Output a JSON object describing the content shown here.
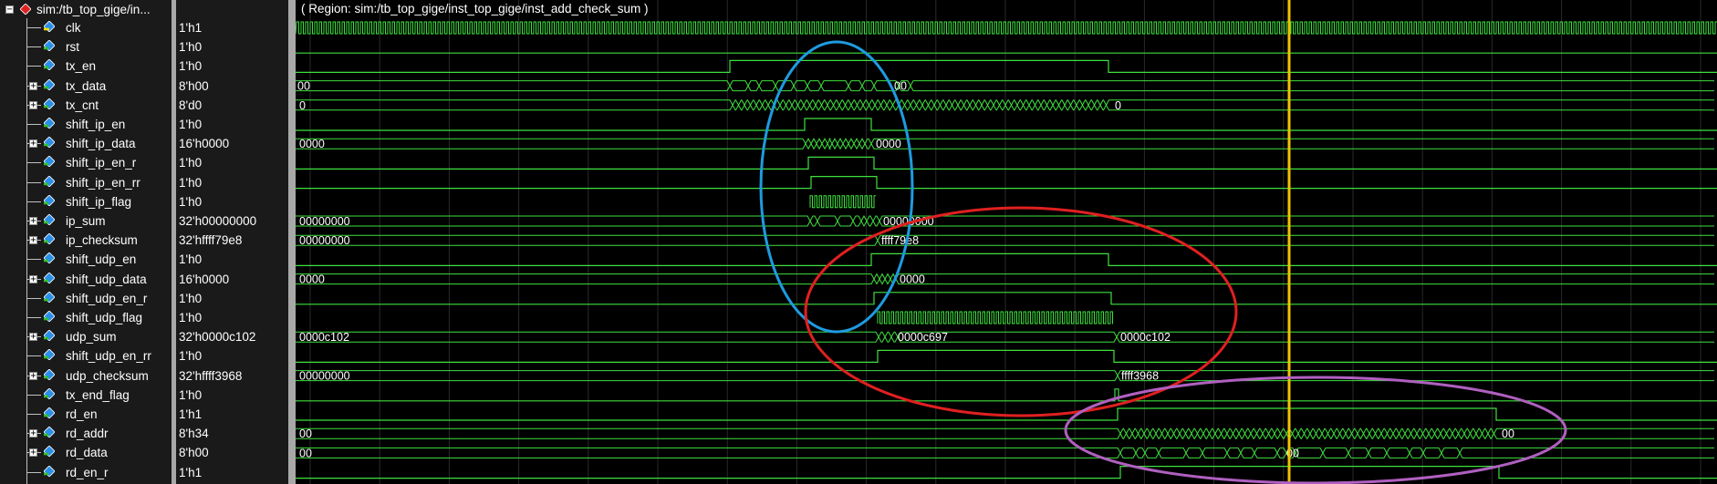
{
  "root_scope": "sim:/tb_top_gige/in...",
  "region_label": "( Region: sim:/tb_top_gige/inst_top_gige/inst_add_check_sum )",
  "colors": {
    "wave": "#3ee03e",
    "cursor": "#f2c200",
    "blue_ellipse": "#1e9be0",
    "red_ellipse": "#e02020",
    "purple_ellipse": "#b060c0"
  },
  "signals": [
    {
      "name": "clk",
      "value": "1'h1",
      "bus": false
    },
    {
      "name": "rst",
      "value": "1'h0",
      "bus": false
    },
    {
      "name": "tx_en",
      "value": "1'h0",
      "bus": false
    },
    {
      "name": "tx_data",
      "value": "8'h00",
      "bus": true
    },
    {
      "name": "tx_cnt",
      "value": "8'd0",
      "bus": true
    },
    {
      "name": "shift_ip_en",
      "value": "1'h0",
      "bus": false
    },
    {
      "name": "shift_ip_data",
      "value": "16'h0000",
      "bus": true
    },
    {
      "name": "shift_ip_en_r",
      "value": "1'h0",
      "bus": false
    },
    {
      "name": "shift_ip_en_rr",
      "value": "1'h0",
      "bus": false
    },
    {
      "name": "shift_ip_flag",
      "value": "1'h0",
      "bus": false
    },
    {
      "name": "ip_sum",
      "value": "32'h00000000",
      "bus": true
    },
    {
      "name": "ip_checksum",
      "value": "32'hffff79e8",
      "bus": true
    },
    {
      "name": "shift_udp_en",
      "value": "1'h0",
      "bus": false
    },
    {
      "name": "shift_udp_data",
      "value": "16'h0000",
      "bus": true
    },
    {
      "name": "shift_udp_en_r",
      "value": "1'h0",
      "bus": false
    },
    {
      "name": "shift_udp_flag",
      "value": "1'h0",
      "bus": false
    },
    {
      "name": "udp_sum",
      "value": "32'h0000c102",
      "bus": true
    },
    {
      "name": "shift_udp_en_rr",
      "value": "1'h0",
      "bus": false
    },
    {
      "name": "udp_checksum",
      "value": "32'hffff3968",
      "bus": true
    },
    {
      "name": "tx_end_flag",
      "value": "1'h0",
      "bus": false
    },
    {
      "name": "rd_en",
      "value": "1'h1",
      "bus": false
    },
    {
      "name": "rd_addr",
      "value": "8'h34",
      "bus": true
    },
    {
      "name": "rd_data",
      "value": "8'h00",
      "bus": true
    },
    {
      "name": "rd_en_r",
      "value": "1'h1",
      "bus": false
    }
  ],
  "wave_labels": {
    "tx_data_start": "00",
    "tx_data_end": "00",
    "tx_cnt_start": "0",
    "tx_cnt_end": "0",
    "shift_ip_data_start": "0000",
    "shift_ip_data_end": "0000",
    "ip_sum_start": "00000000",
    "ip_sum_end": "00000000",
    "ip_checksum_start": "00000000",
    "ip_checksum_end": "ffff79e8",
    "shift_udp_data_start": "0000",
    "shift_udp_data_end": "0000",
    "udp_sum_start": "0000c102",
    "udp_sum_mid": "0000c697",
    "udp_sum_end": "0000c102",
    "udp_checksum_start": "00000000",
    "udp_checksum_end": "ffff3968",
    "rd_addr_start": "00",
    "rd_addr_end": "00",
    "rd_data_start": "00",
    "rd_data_end": "00"
  }
}
